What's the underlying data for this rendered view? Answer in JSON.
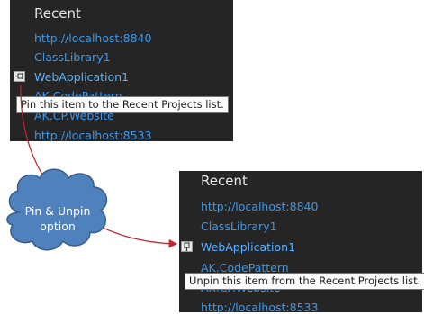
{
  "before_panel": {
    "title": "Recent",
    "items": [
      {
        "label": "http://localhost:8840"
      },
      {
        "label": "ClassLibrary1"
      },
      {
        "label": "WebApplication1"
      },
      {
        "label": "AK.CodePattern"
      },
      {
        "label": "AK.CP.Website"
      },
      {
        "label": "http://localhost:8533"
      }
    ],
    "tooltip": "Pin this item to the Recent Projects list."
  },
  "after_panel": {
    "title": "Recent",
    "items": [
      {
        "label": "http://localhost:8840"
      },
      {
        "label": "ClassLibrary1"
      },
      {
        "label": "WebApplication1"
      },
      {
        "label": "AK.CodePattern"
      },
      {
        "label": "AK.CP.Website"
      },
      {
        "label": "http://localhost:8533"
      }
    ],
    "tooltip": "Unpin this item from the Recent Projects list."
  },
  "callout": {
    "line1": "Pin & Unpin",
    "line2": "option"
  },
  "colors": {
    "panel_bg": "#252526",
    "link": "#3e96e8",
    "cloud_fill": "#4f81bd",
    "arrow": "#c0262b"
  },
  "icons": {
    "pin_unpinned": "pin-icon",
    "pin_pinned": "pinned-icon"
  }
}
